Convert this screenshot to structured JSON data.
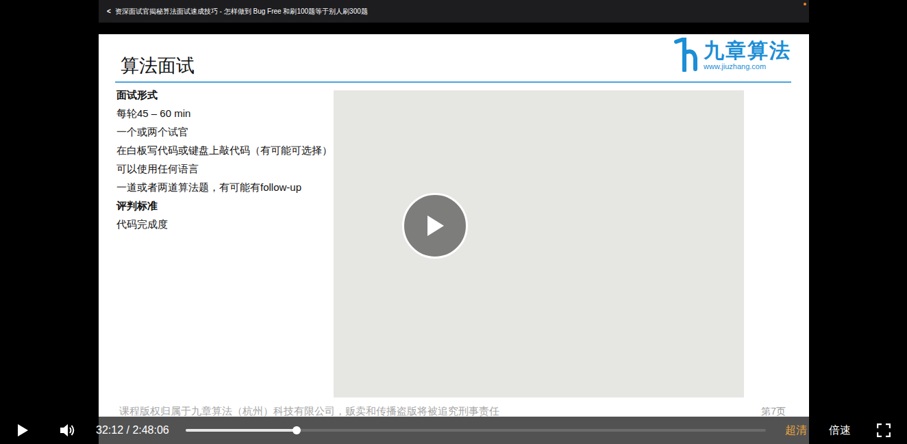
{
  "header": {
    "back": "<",
    "title": "资深面试官揭秘算法面试速成技巧 - 怎样做到 Bug Free 和刷100题等于别人刷300题"
  },
  "slide": {
    "title": "算法面试",
    "logo": {
      "name": "九章算法",
      "url": "www.jiuzhang.com"
    },
    "sections": [
      {
        "heading": "面试形式",
        "items": [
          "每轮45 – 60 min",
          "一个或两个试官",
          "在白板写代码或键盘上敲代码（有可能可选择）",
          "可以使用任何语言",
          "一道或者两道算法题，有可能有follow-up"
        ]
      },
      {
        "heading": "评判标准",
        "items": [
          "代码完成度"
        ]
      }
    ],
    "footer": "课程版权归属于九章算法（杭州）科技有限公司，贩卖和传播盗版将被追究刑事责任",
    "page": "第7页"
  },
  "player": {
    "paused": true,
    "time": "32:12 / 2:48:06",
    "progress": {
      "level": 0.191
    },
    "quality": "超清",
    "speed": "倍速"
  }
}
